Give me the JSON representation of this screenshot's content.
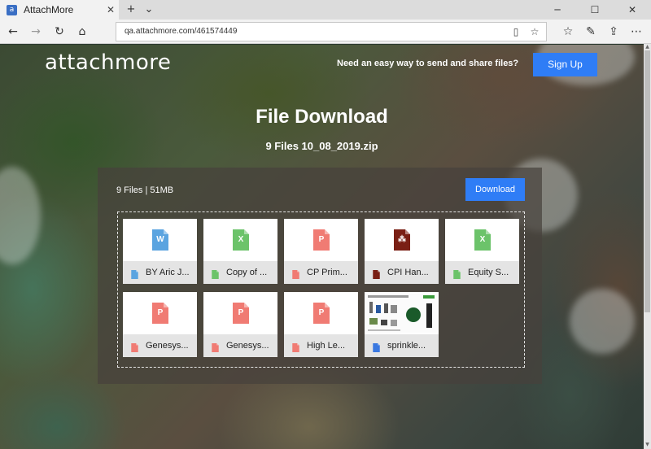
{
  "browser": {
    "tab_title": "AttachMore",
    "url": "qa.attachmore.com/461574449"
  },
  "header": {
    "brand": "attachmore",
    "tagline": "Need an easy way to send and share files?",
    "signup_label": "Sign Up"
  },
  "main": {
    "title": "File Download",
    "subtitle": "9 Files 10_08_2019.zip",
    "summary": "9 Files | 51MB",
    "download_label": "Download"
  },
  "files": [
    {
      "name": "BY Aric J...",
      "type": "word",
      "icon": "word-file-icon",
      "color": "#5ba4e0",
      "glyph": "W"
    },
    {
      "name": "Copy of ...",
      "type": "excel",
      "icon": "excel-file-icon",
      "color": "#6cc36a",
      "glyph": "X"
    },
    {
      "name": "CP Prim...",
      "type": "powerpoint",
      "icon": "powerpoint-file-icon",
      "color": "#f07b73",
      "glyph": "P"
    },
    {
      "name": "CPI Han...",
      "type": "pdf",
      "icon": "pdf-file-icon",
      "color": "#7a1f14",
      "glyph": "⁂"
    },
    {
      "name": "Equity S...",
      "type": "excel",
      "icon": "excel-file-icon",
      "color": "#6cc36a",
      "glyph": "X"
    },
    {
      "name": "Genesys...",
      "type": "powerpoint",
      "icon": "powerpoint-file-icon",
      "color": "#f07b73",
      "glyph": "P"
    },
    {
      "name": "Genesys...",
      "type": "powerpoint",
      "icon": "powerpoint-file-icon",
      "color": "#f07b73",
      "glyph": "P"
    },
    {
      "name": "High Le...",
      "type": "powerpoint",
      "icon": "powerpoint-file-icon",
      "color": "#f07b73",
      "glyph": "P"
    },
    {
      "name": "sprinkle...",
      "type": "image",
      "icon": "image-file-icon",
      "color": "#3a78e0",
      "glyph": ""
    }
  ]
}
